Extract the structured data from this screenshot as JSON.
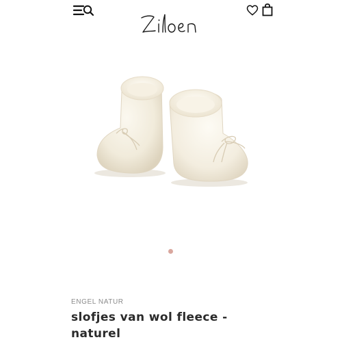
{
  "header": {
    "menu_icon": "menu-icon",
    "search_icon": "search-icon",
    "logo_text": "Ziloen",
    "wishlist_icon": "heart-icon",
    "cart_icon": "shopping-bag-icon"
  },
  "product": {
    "image_alt": "slofjes van wol fleece - naturel",
    "brand": "ENGEL NATUR",
    "title_line1": "slofjes van wol fleece -",
    "title_line2": "naturel"
  },
  "carousel": {
    "slide_count": 1,
    "active_index": 1,
    "dot_color": "#d9a79e"
  }
}
